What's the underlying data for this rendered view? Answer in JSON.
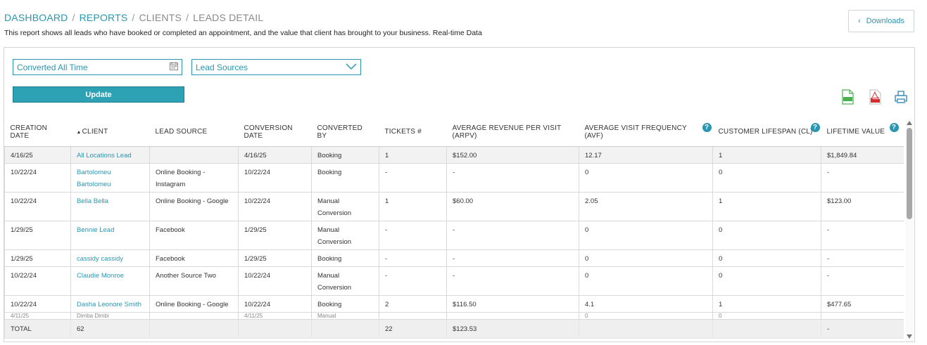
{
  "breadcrumb": {
    "items": [
      "DASHBOARD",
      "REPORTS",
      "CLIENTS",
      "LEADS DETAIL"
    ],
    "separator": "/"
  },
  "subtitle": "This report shows all leads who have booked or completed an appointment, and the value that client has brought to your business. Real-time Data",
  "downloads": {
    "label": "Downloads",
    "icon": "chevron-left-icon"
  },
  "filters": {
    "date_value": "Converted All Time",
    "date_icon": "calendar-icon",
    "source_value": "Lead Sources",
    "source_icon": "chevron-down-icon",
    "update_label": "Update"
  },
  "export_icons": [
    "csv-icon",
    "pdf-icon",
    "print-icon"
  ],
  "table": {
    "headers": {
      "creation_date": "CREATION DATE",
      "client": "CLIENT",
      "lead_source": "LEAD SOURCE",
      "conversion_date": "CONVERSION DATE",
      "converted_by": "CONVERTED BY",
      "tickets": "TICKETS #",
      "arpv": "AVERAGE REVENUE PER VISIT (ARPV)",
      "avf": "AVERAGE VISIT FREQUENCY (AVF)",
      "cl": "CUSTOMER LIFESPAN (CL)",
      "ltv": "LIFETIME VALUE"
    },
    "rows": [
      {
        "creation_date": "4/16/25",
        "client": "All Locations Lead",
        "lead_source": "",
        "conversion_date": "4/16/25",
        "converted_by": "Booking",
        "tickets": "1",
        "arpv": "$152.00",
        "avf": "12.17",
        "cl": "1",
        "ltv": "$1,849.84"
      },
      {
        "creation_date": "10/22/24",
        "client": "Bartolomeu Bartolomeu",
        "lead_source": "Online Booking - Instagram",
        "conversion_date": "10/22/24",
        "converted_by": "Booking",
        "tickets": "-",
        "arpv": "-",
        "avf": "0",
        "cl": "0",
        "ltv": "-"
      },
      {
        "creation_date": "10/22/24",
        "client": "Bella Bella",
        "lead_source": "Online Booking - Google",
        "conversion_date": "10/22/24",
        "converted_by": "Manual Conversion",
        "tickets": "1",
        "arpv": "$60.00",
        "avf": "2.05",
        "cl": "1",
        "ltv": "$123.00"
      },
      {
        "creation_date": "1/29/25",
        "client": "Bennie Lead",
        "lead_source": "Facebook",
        "conversion_date": "1/29/25",
        "converted_by": "Manual Conversion",
        "tickets": "-",
        "arpv": "-",
        "avf": "0",
        "cl": "0",
        "ltv": "-"
      },
      {
        "creation_date": "1/29/25",
        "client": "cassidy cassidy",
        "lead_source": "Facebook",
        "conversion_date": "1/29/25",
        "converted_by": "Booking",
        "tickets": "-",
        "arpv": "-",
        "avf": "0",
        "cl": "0",
        "ltv": "-"
      },
      {
        "creation_date": "10/22/24",
        "client": "Claudie Monroe",
        "lead_source": "Another Source Two",
        "conversion_date": "10/22/24",
        "converted_by": "Manual Conversion",
        "tickets": "-",
        "arpv": "-",
        "avf": "0",
        "cl": "0",
        "ltv": "-"
      },
      {
        "creation_date": "10/22/24",
        "client": "Dasha Leonore Smith",
        "lead_source": "Online Booking - Google",
        "conversion_date": "10/22/24",
        "converted_by": "Booking",
        "tickets": "2",
        "arpv": "$116.50",
        "avf": "4.1",
        "cl": "1",
        "ltv": "$477.65"
      }
    ],
    "partial_row": {
      "creation_date": "4/11/25",
      "client": "Dimba Dimbi",
      "lead_source": "",
      "conversion_date": "4/11/25",
      "converted_by": "Manual",
      "tickets": "",
      "arpv": "",
      "avf": "0",
      "cl": "0",
      "ltv": ""
    },
    "total": {
      "label": "TOTAL",
      "client": "62",
      "tickets": "22",
      "arpv": "$123.53",
      "ltv": "-"
    }
  }
}
